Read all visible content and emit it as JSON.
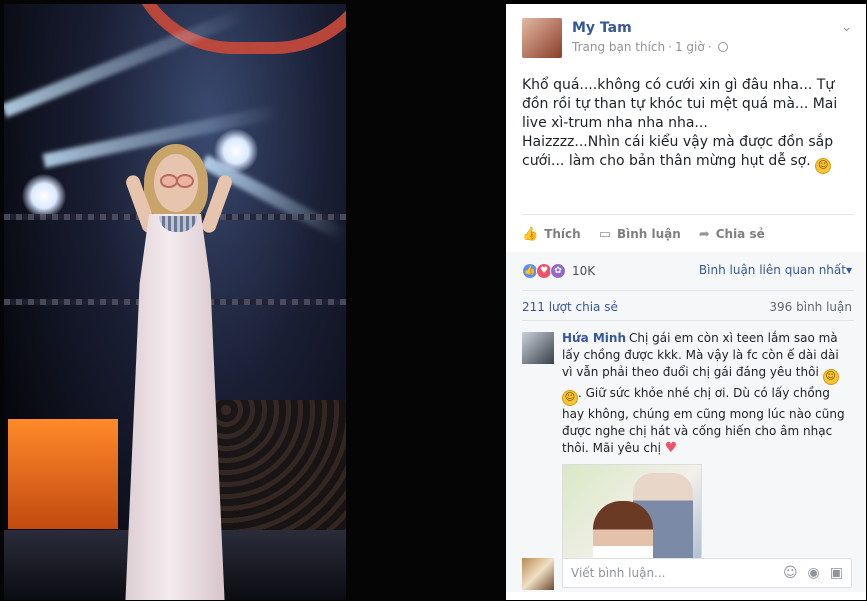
{
  "post": {
    "author": "My Tam",
    "meta_prefix": "Trang bạn thích",
    "meta_separator": "·",
    "time": "1 giờ",
    "text_p1": "Khổ quá....không có cưới xin gì đâu nha... Tự đồn rồi tự than tự khóc tui mệt quá mà... Mai live xì-trum nha nha nha...",
    "text_p2": "Haizzzz...Nhìn cái kiểu vậy mà được đồn sắp cưới... làm cho bản thân mừng hụt dễ sợ."
  },
  "actions": {
    "like": "Thích",
    "comment": "Bình luận",
    "share": "Chia sẻ"
  },
  "reactions": {
    "count": "10K",
    "sort_label": "Bình luận liên quan nhất"
  },
  "stats": {
    "shares": "211 lượt chia sẻ",
    "comments": "396 bình luận"
  },
  "comment": {
    "name": "Hứa Minh",
    "text": "Chị gái em còn xì teen lắm sao mà lấy chồng được kkk. Mà vậy là fc còn ế dài dài vì vẫn phải theo đuổi chị gái đáng yêu thôi",
    "text2": ". Giữ sức khỏe nhé chị ơi. Dù có lấy chồng hay không, chúng em cũng mong lúc nào cũng được nghe chị hát và cống hiến cho âm nhạc thôi. Mãi yêu chị"
  },
  "compose": {
    "placeholder": "Viết bình luận..."
  },
  "icons": {
    "dropdown": "chevron-down-icon",
    "privacy": "globe-icon",
    "like": "thumbs-up-icon",
    "comment": "speech-bubble-icon",
    "share": "share-arrow-icon",
    "emoji": "smiley-icon",
    "camera": "camera-icon",
    "sticker": "sticker-icon"
  },
  "colors": {
    "link": "#365899",
    "like_reaction": "#5890ff",
    "love_reaction": "#f25268",
    "wow_reaction": "#8f6bcb"
  }
}
